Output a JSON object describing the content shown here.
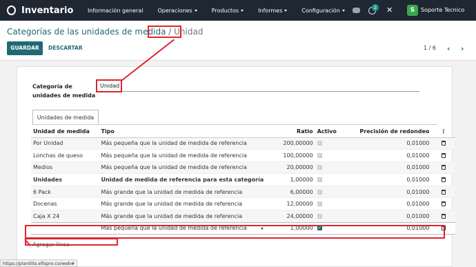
{
  "navbar": {
    "app_name": "Inventario",
    "menu": [
      {
        "label": "Información general",
        "dropdown": false
      },
      {
        "label": "Operaciones",
        "dropdown": true
      },
      {
        "label": "Productos",
        "dropdown": true
      },
      {
        "label": "Informes",
        "dropdown": true
      },
      {
        "label": "Configuración",
        "dropdown": true
      }
    ],
    "activity_badge": "2",
    "avatar_letter": "S",
    "user_name": "Soporte Tecnico"
  },
  "breadcrumb": {
    "parent": "Categorías de las unidades de medida",
    "separator": "/",
    "current": "Unidad"
  },
  "toolbar": {
    "save_label": "GUARDAR",
    "discard_label": "DESCARTAR",
    "pager": "1 / 6",
    "prev": "‹",
    "next": "›"
  },
  "form": {
    "category_label": "Categoría de unidades de medida",
    "category_value": "Unidad",
    "tab_label": "Unidades de medida"
  },
  "grid": {
    "headers": {
      "unit": "Unidad de medida",
      "type": "Tipo",
      "ratio": "Ratio",
      "active": "Activo",
      "rounding": "Precisión de redondeo"
    },
    "rows": [
      {
        "unit": "Por Unidad",
        "type": "Más pequeña que la unidad de medida de referencia",
        "ratio": "200,00000",
        "active": true,
        "rounding": "0,01000"
      },
      {
        "unit": "Lonchas de queso",
        "type": "Más pequeña que la unidad de medida de referencia",
        "ratio": "100,00000",
        "active": true,
        "rounding": "0,01000"
      },
      {
        "unit": "Medios",
        "type": "Más pequeña que la unidad de medida de referencia",
        "ratio": "20,00000",
        "active": true,
        "rounding": "0,01000"
      },
      {
        "unit": "Unidades",
        "type": "Unidad de medida de referencia para esta categoría",
        "ratio": "1,00000",
        "active": true,
        "rounding": "0,01000"
      },
      {
        "unit": "6 Pack",
        "type": "Más grande que la unidad de medida de referencia",
        "ratio": "6,00000",
        "active": true,
        "rounding": "0,01000"
      },
      {
        "unit": "Docenas",
        "type": "Más grande que la unidad de medida de referencia",
        "ratio": "12,00000",
        "active": true,
        "rounding": "0,01000"
      },
      {
        "unit": "Caja X 24",
        "type": "Más grande que la unidad de medida de referencia",
        "ratio": "24,00000",
        "active": true,
        "rounding": "0,01000"
      }
    ],
    "edit_row": {
      "unit": "",
      "type": "Más pequeña que la unidad de medida de referencia",
      "ratio": "1,00000",
      "active": true,
      "rounding": "0,01000"
    },
    "add_line_label": "Agregar línea"
  },
  "statusbar": {
    "url": "https://plantilla.efispro.co/web#"
  },
  "colors": {
    "primary": "#1f6a75",
    "navbar": "#1f2733",
    "annotation": "#e0232d"
  }
}
